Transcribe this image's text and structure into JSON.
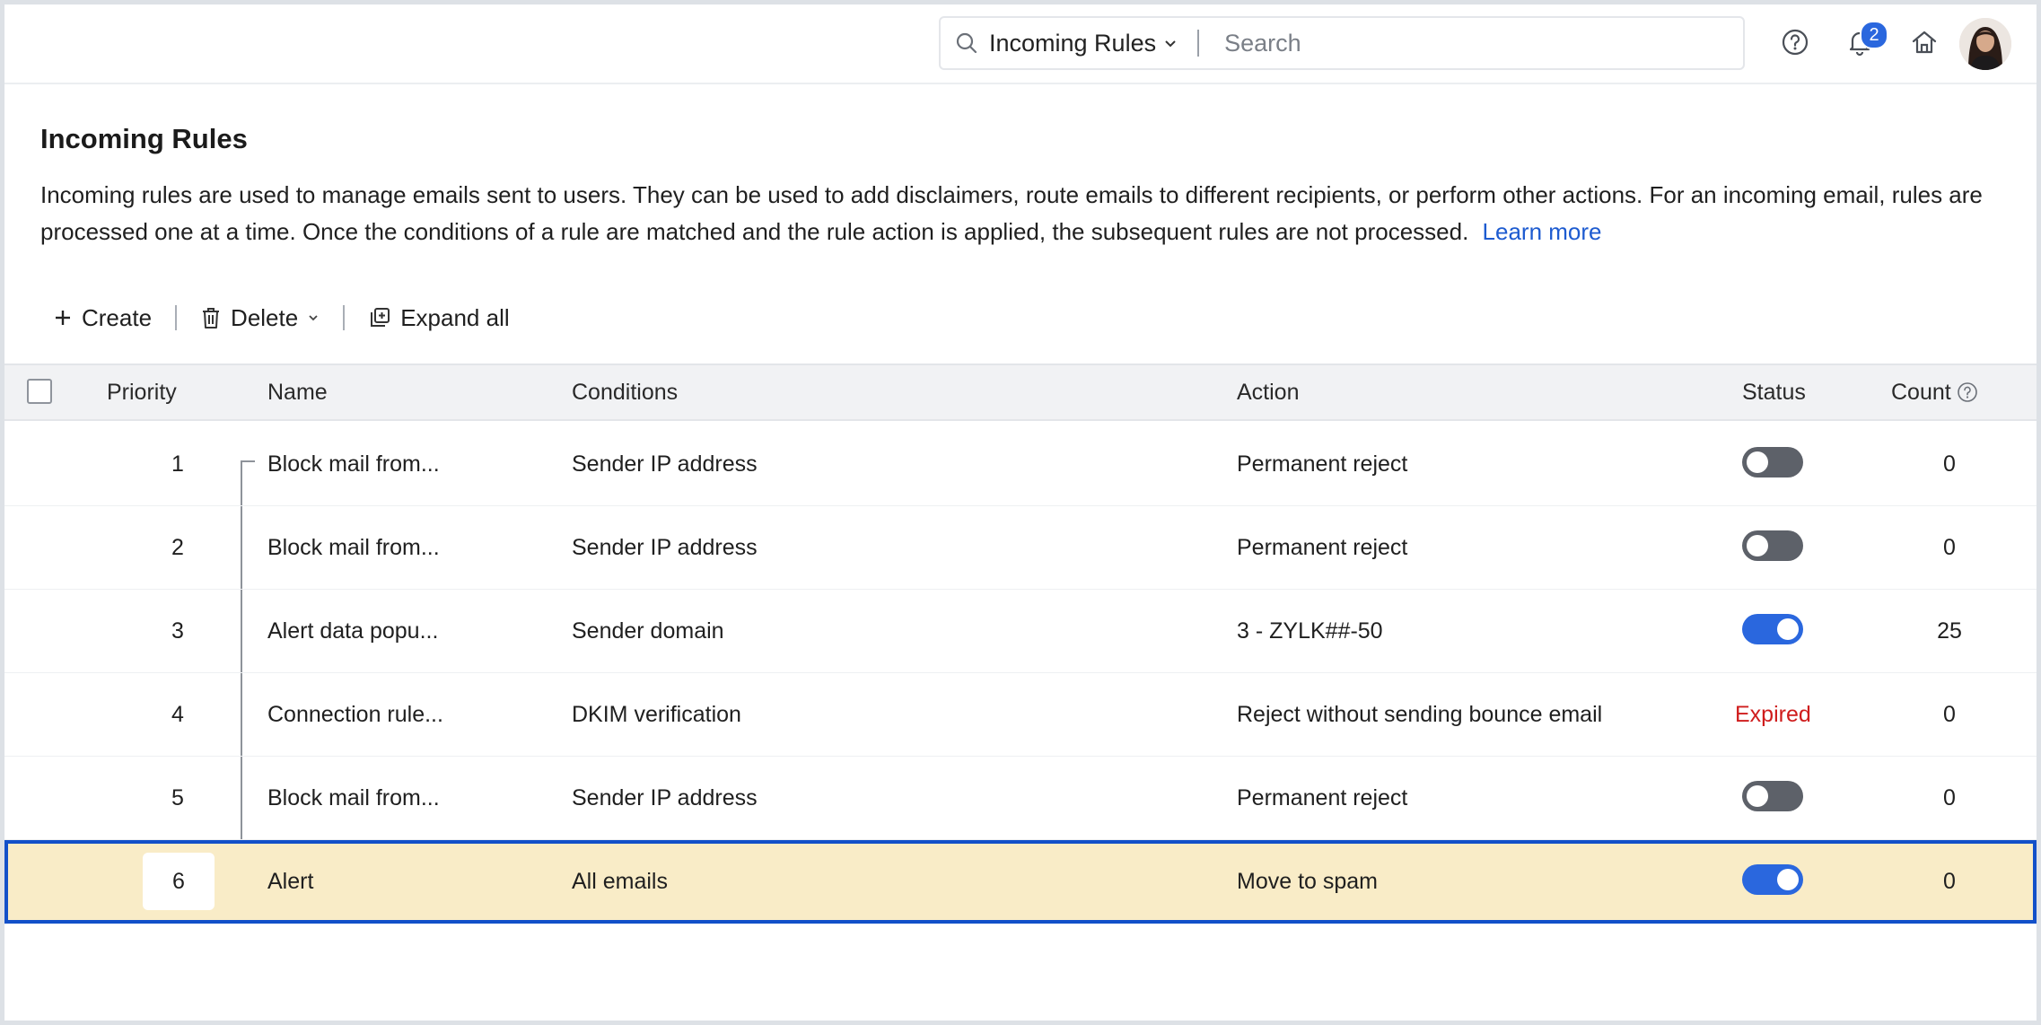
{
  "search": {
    "scope_label": "Incoming Rules",
    "placeholder": "Search"
  },
  "notifications": {
    "count": "2"
  },
  "header": {
    "title": "Incoming Rules",
    "description": "Incoming rules are used to manage emails sent to users. They can be used to add disclaimers, route emails to different recipients, or perform other actions. For an incoming email, rules are processed one at a time. Once the conditions of a rule are matched and the rule action is applied, the subsequent rules are not processed.",
    "learn_more": "Learn more"
  },
  "toolbar": {
    "create_label": "Create",
    "delete_label": "Delete",
    "expand_label": "Expand all"
  },
  "table": {
    "columns": {
      "priority": "Priority",
      "name": "Name",
      "conditions": "Conditions",
      "action": "Action",
      "status": "Status",
      "count": "Count"
    },
    "rows": [
      {
        "priority": "1",
        "name": "Block mail from...",
        "conditions": "Sender IP address",
        "action": "Permanent reject",
        "status": "off",
        "count": "0"
      },
      {
        "priority": "2",
        "name": "Block mail from...",
        "conditions": "Sender IP address",
        "action": "Permanent reject",
        "status": "off",
        "count": "0"
      },
      {
        "priority": "3",
        "name": "Alert data popu...",
        "conditions": "Sender domain",
        "action": "3 - ZYLK##-50",
        "status": "on",
        "count": "25"
      },
      {
        "priority": "4",
        "name": "Connection rule...",
        "conditions": "DKIM verification",
        "action": "Reject without sending bounce email",
        "status": "Expired",
        "count": "0"
      },
      {
        "priority": "5",
        "name": "Block mail from...",
        "conditions": "Sender IP address",
        "action": "Permanent reject",
        "status": "off",
        "count": "0"
      },
      {
        "priority": "6",
        "name": "Alert",
        "conditions": "All emails",
        "action": "Move to spam",
        "status": "on",
        "count": "0"
      }
    ]
  },
  "colors": {
    "accent": "#2a67de",
    "toggle_off": "#5d6169",
    "expired": "#cf1c1c",
    "selected_row": "#f9ecc7",
    "selected_outline": "#1250c9",
    "link": "#1d5bd0"
  }
}
